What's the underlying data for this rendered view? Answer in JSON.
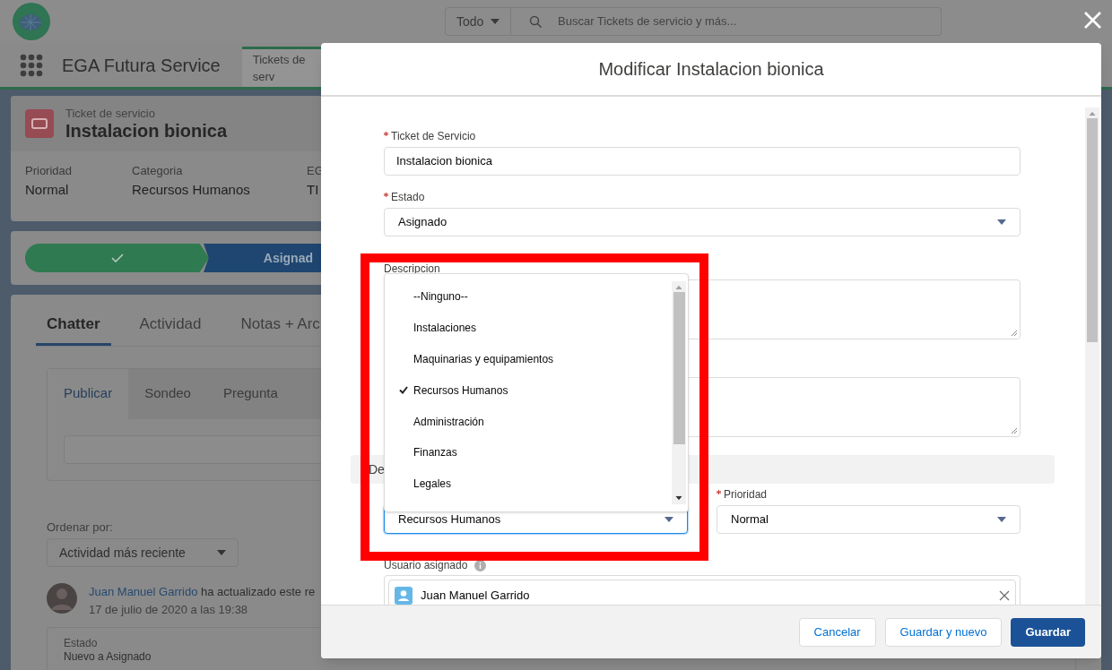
{
  "global_header": {
    "search_scope": "Todo",
    "search_placeholder": "Buscar Tickets de servicio y más..."
  },
  "app_nav": {
    "app_name": "EGA Futura Service",
    "tabs": [
      {
        "label": "Tickets de serv",
        "selected": true
      }
    ]
  },
  "record_header": {
    "object_type": "Ticket de servicio",
    "title": "Instalacion bionica",
    "fields": [
      {
        "label": "Prioridad",
        "value": "Normal"
      },
      {
        "label": "Categoria",
        "value": "Recursos Humanos"
      },
      {
        "label": "EG",
        "value": "TI"
      }
    ]
  },
  "path": {
    "steps": [
      {
        "kind": "complete"
      },
      {
        "kind": "current",
        "label": "Asignad"
      }
    ]
  },
  "record_tabs": [
    {
      "label": "Chatter",
      "selected": true
    },
    {
      "label": "Actividad",
      "selected": false
    },
    {
      "label": "Notas + Arc",
      "selected": false
    }
  ],
  "publisher": {
    "tabs": [
      {
        "label": "Publicar",
        "selected": true
      },
      {
        "label": "Sondeo",
        "selected": false
      },
      {
        "label": "Pregunta",
        "selected": false
      }
    ]
  },
  "feed": {
    "sort_label": "Ordenar por:",
    "sort_value": "Actividad más reciente",
    "items": [
      {
        "author": "Juan Manuel Garrido",
        "action": "ha actualizado este re",
        "date": "17 de julio de 2020 a las 19:38",
        "changes": [
          {
            "field": "Estado",
            "value": "Nuevo a Asignado"
          }
        ]
      }
    ]
  },
  "modal": {
    "title": "Modificar Instalacion bionica",
    "fields": [
      {
        "kind": "text",
        "label": "Ticket de Servicio",
        "required": true,
        "value": "Instalacion bionica"
      },
      {
        "kind": "select",
        "label": "Estado",
        "required": true,
        "value": "Asignado"
      },
      {
        "kind": "textarea",
        "label": "Descripcion"
      },
      {
        "kind": "textarea"
      }
    ],
    "section": {
      "title": "De"
    },
    "columns": [
      {
        "kind": "select",
        "value": "Recursos Humanos",
        "focused": true
      },
      {
        "kind": "select",
        "label": "Prioridad",
        "required": true,
        "value": "Normal",
        "focused": false
      }
    ],
    "lookup": {
      "label": "Usuario asignado",
      "value": "Juan Manuel Garrido"
    },
    "picklist": {
      "options": [
        {
          "label": "--Ninguno--",
          "selected": false
        },
        {
          "label": "Instalaciones",
          "selected": false
        },
        {
          "label": "Maquinarias y equipamientos",
          "selected": false
        },
        {
          "label": "Recursos Humanos",
          "selected": true
        },
        {
          "label": "Administración",
          "selected": false
        },
        {
          "label": "Finanzas",
          "selected": false
        },
        {
          "label": "Legales",
          "selected": false
        }
      ]
    },
    "buttons": [
      {
        "kind": "neutral",
        "label": "Cancelar"
      },
      {
        "kind": "neutral",
        "label": "Guardar y nuevo"
      },
      {
        "kind": "brand",
        "label": "Guardar"
      }
    ]
  }
}
